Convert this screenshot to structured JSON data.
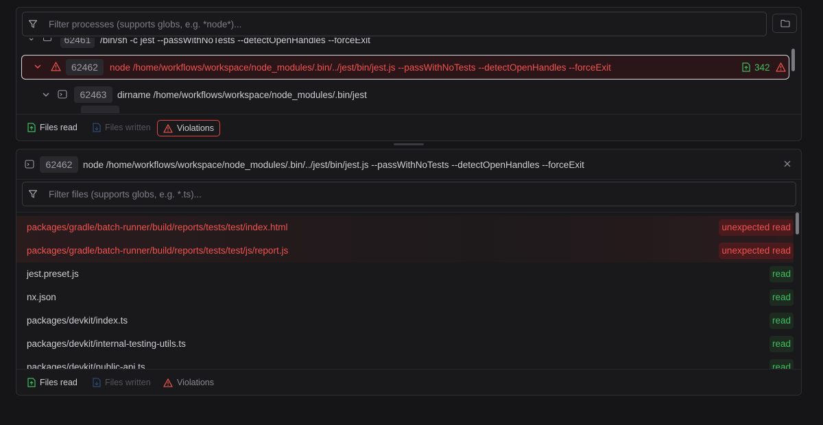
{
  "process_panel": {
    "filter_placeholder": "Filter processes (supports globs, e.g. *node*)...",
    "rows": [
      {
        "pid": "62461",
        "command": "/bin/sh -c jest --passWithNoTests --detectOpenHandles --forceExit"
      },
      {
        "pid": "62462",
        "command": "node /home/workflows/workspace/node_modules/.bin/../jest/bin/jest.js --passWithNoTests --detectOpenHandles --forceExit",
        "files_read_count": "342"
      },
      {
        "pid": "62463",
        "command": "dirname /home/workflows/workspace/node_modules/.bin/jest"
      }
    ],
    "footer": {
      "files_read": "Files read",
      "files_written": "Files written",
      "violations": "Violations"
    }
  },
  "detail_panel": {
    "pid": "62462",
    "command": "node /home/workflows/workspace/node_modules/.bin/../jest/bin/jest.js --passWithNoTests --detectOpenHandles --forceExit",
    "filter_placeholder": "Filter files (supports globs, e.g. *.ts)...",
    "files": [
      {
        "path": "packages/gradle/batch-runner/build/reports/tests/test/index.html",
        "status": "unexpected read"
      },
      {
        "path": "packages/gradle/batch-runner/build/reports/tests/test/js/report.js",
        "status": "unexpected read"
      },
      {
        "path": "jest.preset.js",
        "status": "read"
      },
      {
        "path": "nx.json",
        "status": "read"
      },
      {
        "path": "packages/devkit/index.ts",
        "status": "read"
      },
      {
        "path": "packages/devkit/internal-testing-utils.ts",
        "status": "read"
      },
      {
        "path": "packages/devkit/public-api.ts",
        "status": "read"
      }
    ],
    "footer": {
      "files_read": "Files read",
      "files_written": "Files written",
      "violations": "Violations"
    }
  },
  "colors": {
    "accent_red": "#ef5350",
    "accent_green": "#3fbf5f",
    "background": "#151517"
  }
}
